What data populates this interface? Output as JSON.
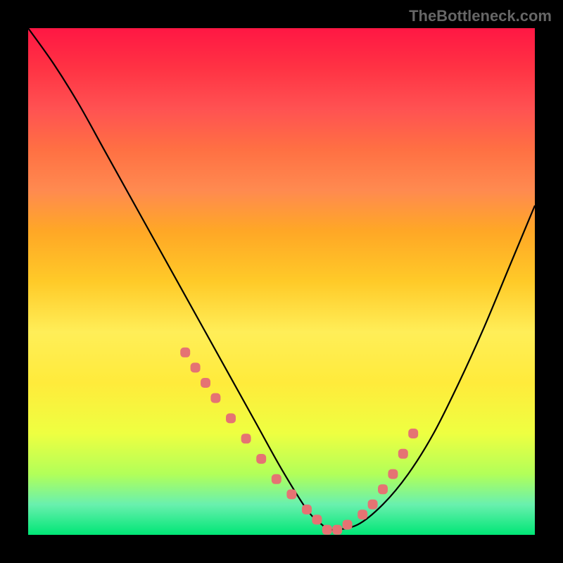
{
  "watermark": "TheBottleneck.com",
  "chart_data": {
    "type": "line",
    "title": "",
    "xlabel": "",
    "ylabel": "",
    "xlim": [
      0,
      100
    ],
    "ylim": [
      0,
      100
    ],
    "series": [
      {
        "name": "curve",
        "x": [
          0,
          5,
          10,
          15,
          20,
          25,
          30,
          35,
          40,
          45,
          50,
          55,
          58,
          60,
          65,
          70,
          75,
          80,
          85,
          90,
          95,
          100
        ],
        "values": [
          100,
          93,
          85,
          76,
          67,
          58,
          49,
          40,
          31,
          22,
          13,
          5,
          2,
          1,
          2,
          6,
          12,
          20,
          30,
          41,
          53,
          65
        ]
      }
    ],
    "markers": {
      "name": "highlight-dots",
      "color": "#e57373",
      "x": [
        31,
        33,
        35,
        37,
        40,
        43,
        46,
        49,
        52,
        55,
        57,
        59,
        61,
        63,
        66,
        68,
        70,
        72,
        74,
        76
      ],
      "values": [
        36,
        33,
        30,
        27,
        23,
        19,
        15,
        11,
        8,
        5,
        3,
        1,
        1,
        2,
        4,
        6,
        9,
        12,
        16,
        20
      ]
    }
  }
}
